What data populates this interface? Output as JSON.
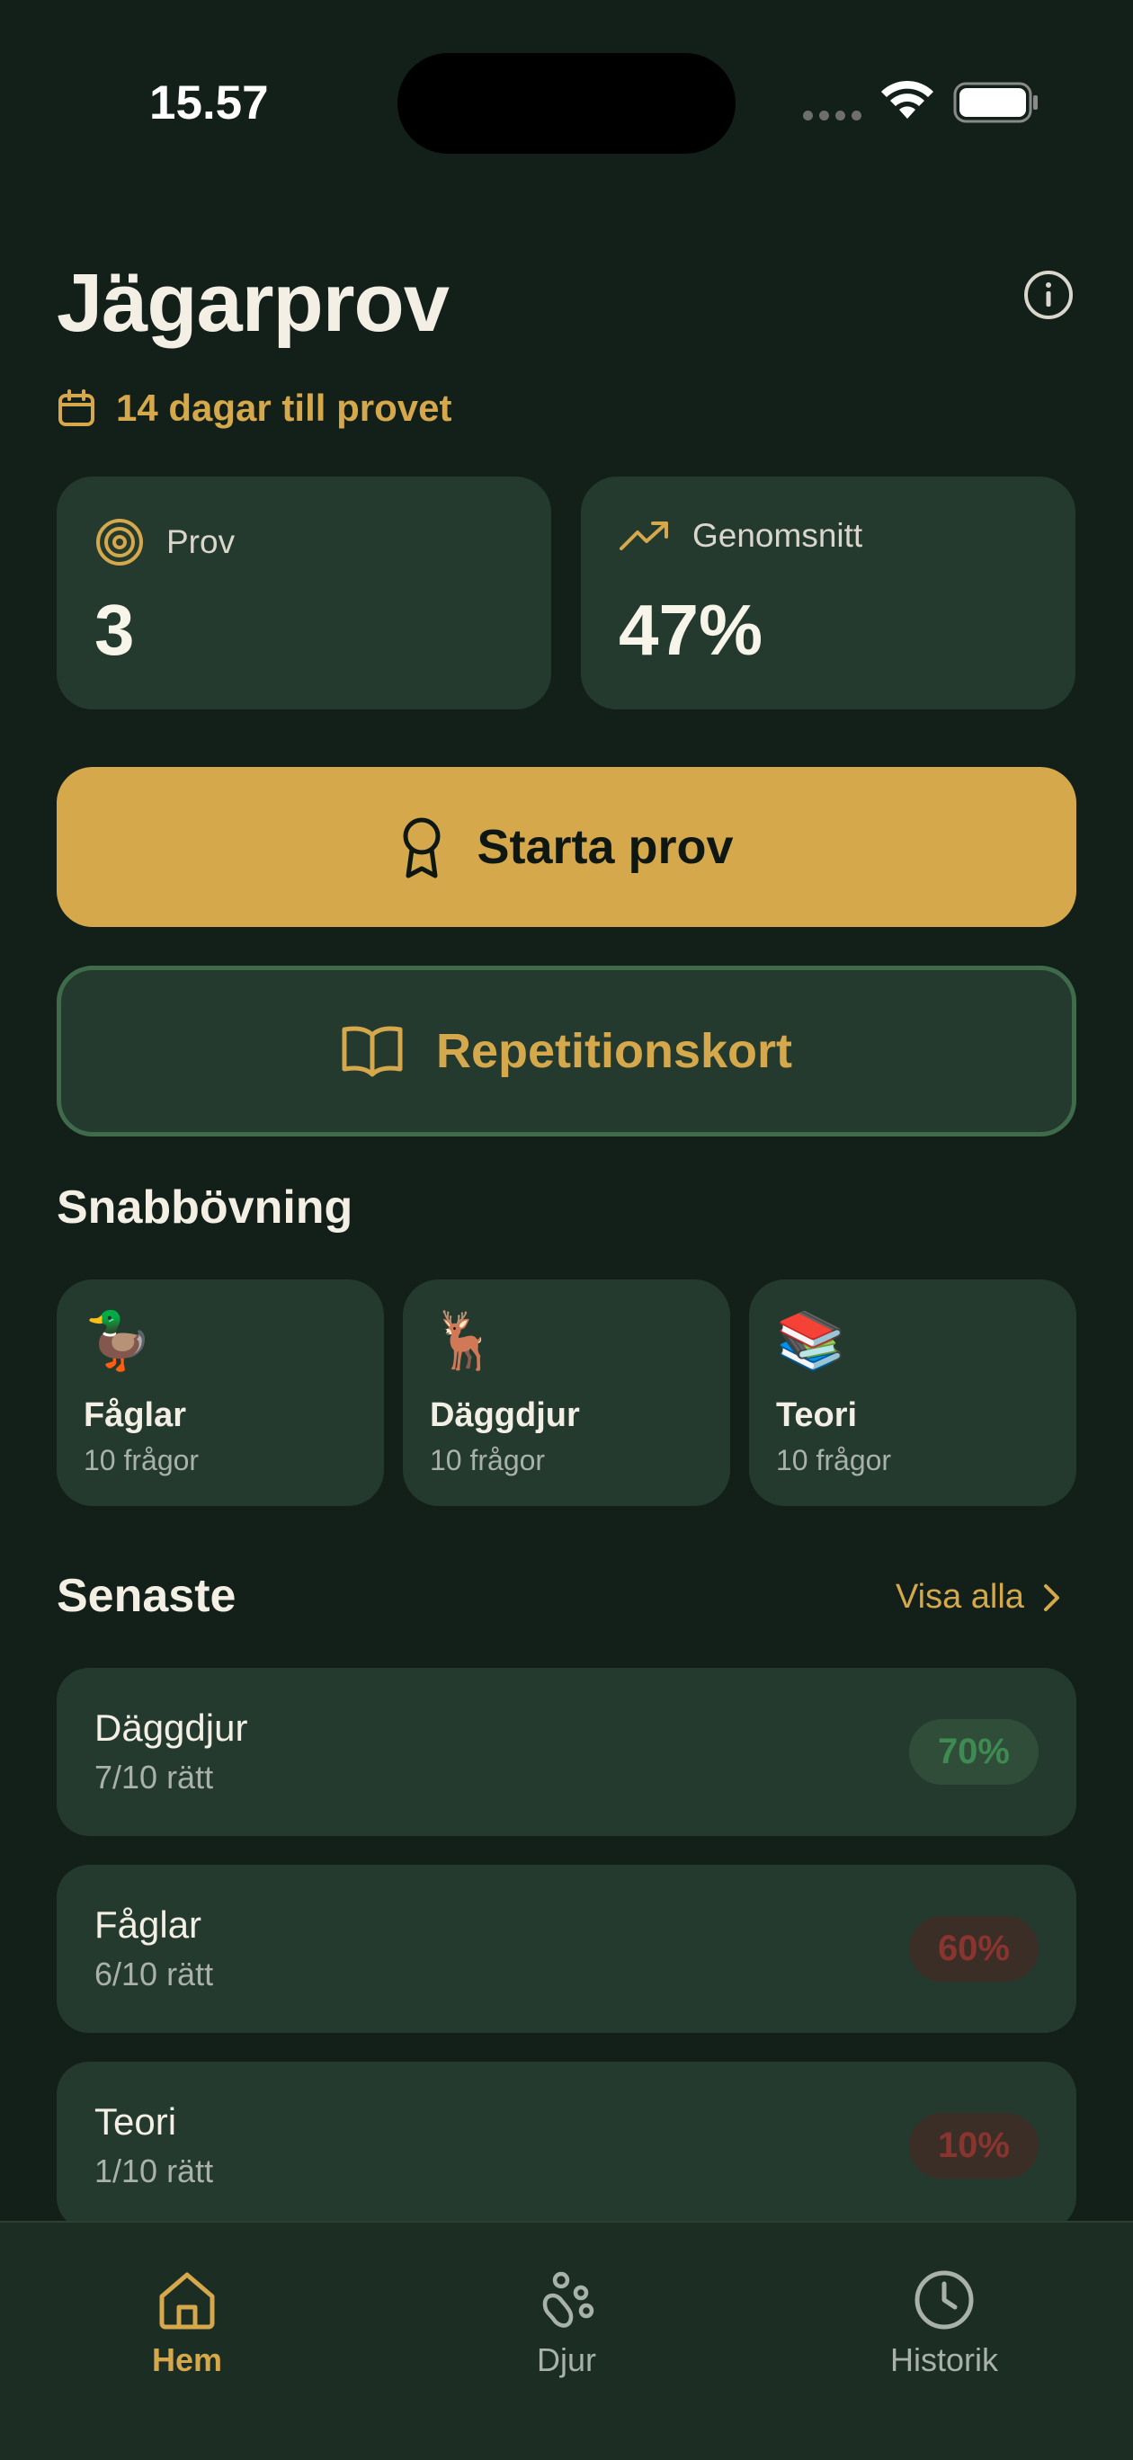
{
  "status_bar": {
    "time": "15.57"
  },
  "header": {
    "title": "Jägarprov",
    "countdown": "14 dagar till provet"
  },
  "stats": [
    {
      "label": "Prov",
      "value": "3"
    },
    {
      "label": "Genomsnitt",
      "value": "47%"
    }
  ],
  "actions": {
    "start_label": "Starta prov",
    "repetition_label": "Repetitionskort"
  },
  "quick_practice": {
    "title": "Snabbövning",
    "items": [
      {
        "emoji": "🦆",
        "name": "Fåglar",
        "count": "10 frågor"
      },
      {
        "emoji": "🦌",
        "name": "Däggdjur",
        "count": "10 frågor"
      },
      {
        "emoji": "📚",
        "name": "Teori",
        "count": "10 frågor"
      }
    ]
  },
  "recent": {
    "title": "Senaste",
    "see_all": "Visa alla",
    "items": [
      {
        "name": "Däggdjur",
        "score": "7/10 rätt",
        "percent": "70%"
      },
      {
        "name": "Fåglar",
        "score": "6/10 rätt",
        "percent": "60%"
      },
      {
        "name": "Teori",
        "score": "1/10 rätt",
        "percent": "10%"
      }
    ]
  },
  "tabs": [
    {
      "label": "Hem",
      "icon": "home-icon"
    },
    {
      "label": "Djur",
      "icon": "paw-icon"
    },
    {
      "label": "Historik",
      "icon": "clock-icon"
    }
  ],
  "colors": {
    "background": "#13201a",
    "card": "#253a2f",
    "accent": "#d4a84b",
    "good": "#3f8a52",
    "bad": "#8a3430"
  }
}
